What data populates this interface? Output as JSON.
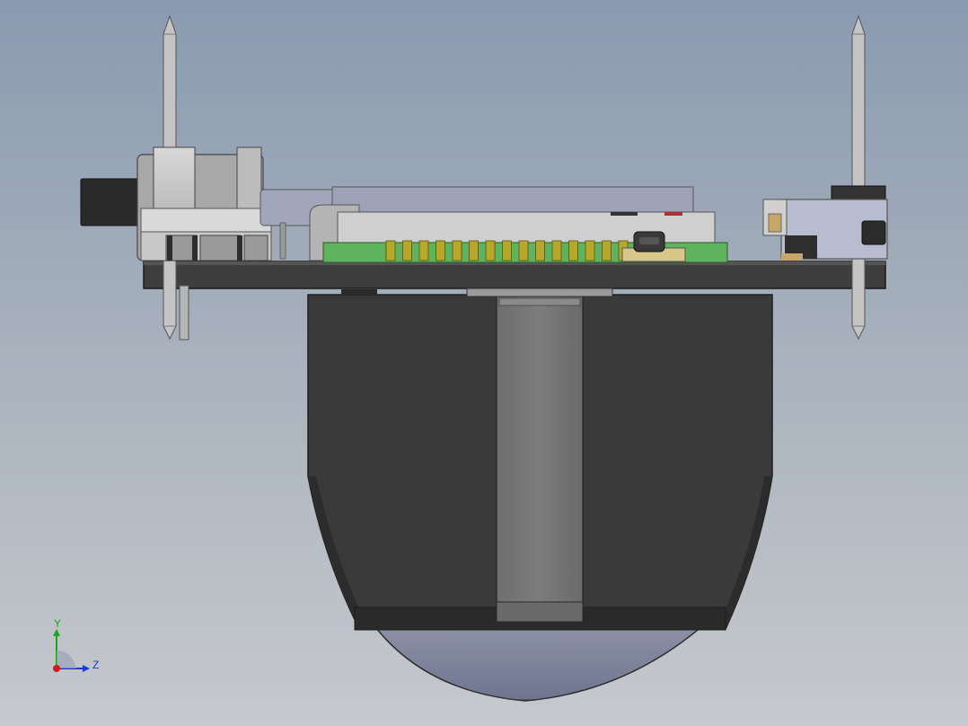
{
  "view": {
    "triad": {
      "y_label": "Y",
      "z_label": "Z",
      "y_color": "#1aa61a",
      "z_color": "#1a3ad9",
      "x_color": "#d41a1a"
    },
    "colors": {
      "dark_housing": "#3a3a3a",
      "pcb_green": "#5fb35f",
      "pin_gold": "#b8a82a",
      "metal": "#c6c6c6",
      "board": "#3c3c3c"
    }
  }
}
